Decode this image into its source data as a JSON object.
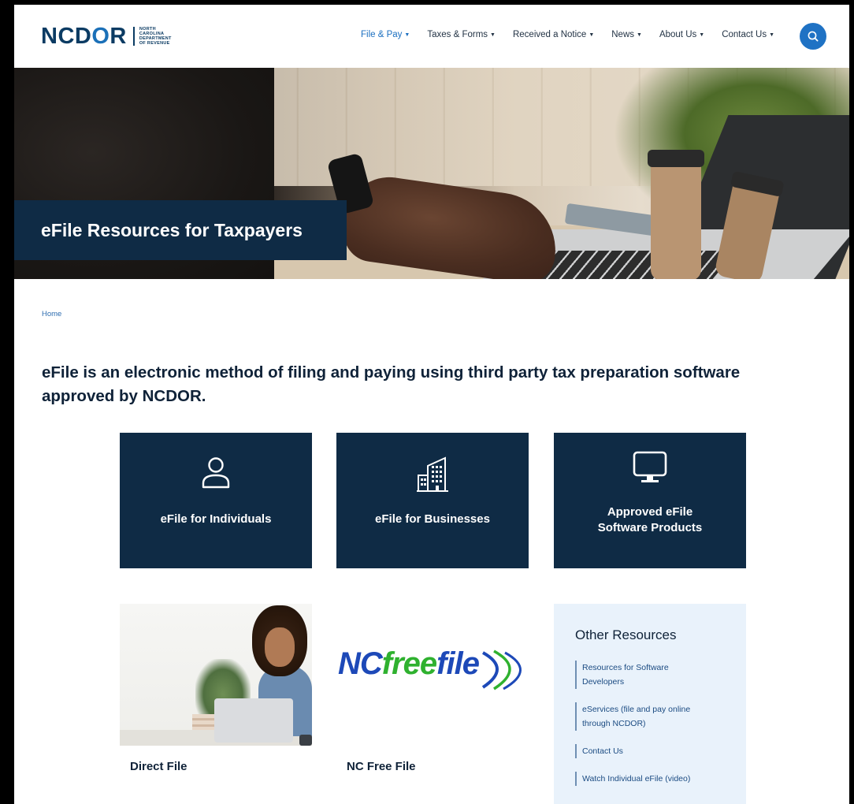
{
  "header": {
    "logo_text_a": "NCD",
    "logo_text_o": "O",
    "logo_text_b": "R",
    "logo_tag": [
      "NORTH",
      "CAROLINA",
      "DEPARTMENT",
      "OF REVENUE"
    ],
    "nav": [
      {
        "label": "File & Pay",
        "active": true
      },
      {
        "label": "Taxes & Forms",
        "active": false
      },
      {
        "label": "Received a Notice",
        "active": false
      },
      {
        "label": "News",
        "active": false
      },
      {
        "label": "About Us",
        "active": false
      },
      {
        "label": "Contact Us",
        "active": false
      }
    ],
    "caret": "▼",
    "search_icon": "search-icon"
  },
  "hero": {
    "title": "eFile Resources for Taxpayers"
  },
  "breadcrumb": {
    "home": "Home"
  },
  "intro": {
    "text": "eFile is an electronic method of filing and paying using third party tax preparation software approved by NCDOR."
  },
  "tiles": [
    {
      "label": "eFile for Individuals",
      "icon": "person-icon"
    },
    {
      "label": "eFile for Businesses",
      "icon": "building-icon"
    },
    {
      "label_line1": "Approved eFile",
      "label_line2": "Software Products",
      "icon": "monitor-icon"
    }
  ],
  "cards": [
    {
      "title": "Direct File"
    },
    {
      "title": "NC Free File",
      "logo_nc": "NC",
      "logo_free": "free",
      "logo_file": "file"
    }
  ],
  "other_resources": {
    "title": "Other Resources",
    "links": [
      "Resources for Software Developers",
      "eServices (file and pay online through NCDOR)",
      "Contact Us",
      "Watch Individual eFile (video)"
    ]
  },
  "colors": {
    "navy": "#0f2b45",
    "link_blue": "#1b6fc0",
    "search_blue": "#1f72c4",
    "panel_bg": "#e9f2fb"
  }
}
